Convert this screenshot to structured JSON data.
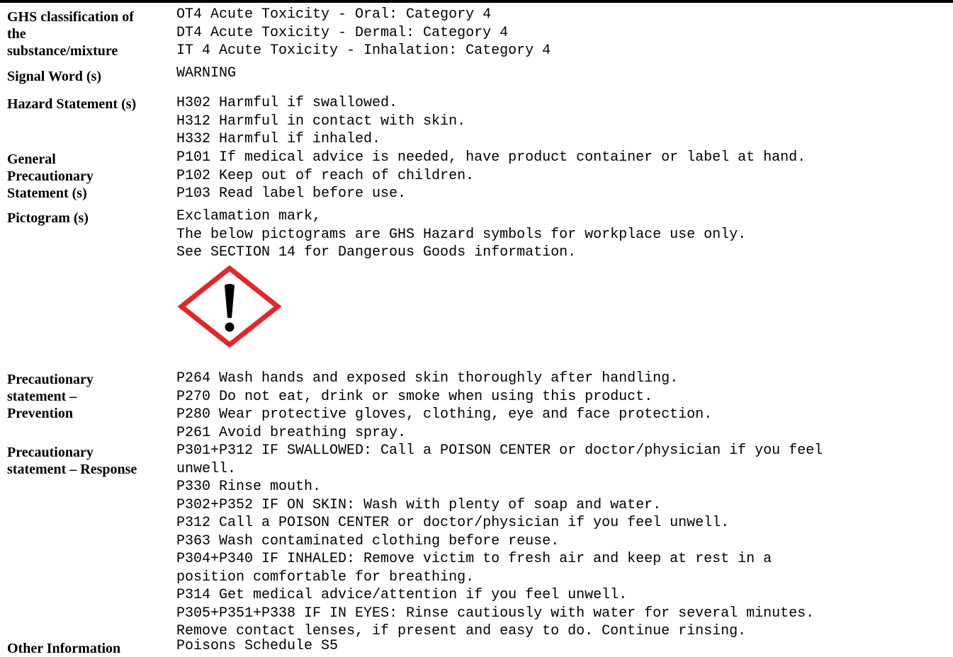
{
  "sections": [
    {
      "id": "ghs",
      "label_lines": [
        "GHS classification of",
        "the",
        "substance/mixture"
      ],
      "lines": [
        "OT4 Acute Toxicity - Oral: Category 4",
        "DT4 Acute Toxicity - Dermal: Category 4",
        "IT 4 Acute Toxicity - Inhalation: Category 4"
      ]
    },
    {
      "id": "signal",
      "label_lines": [
        "Signal Word (s)"
      ],
      "lines": [
        "WARNING"
      ]
    },
    {
      "id": "hazard",
      "label_lines": [
        "Hazard Statement (s)"
      ],
      "lines": [
        "H302 Harmful if swallowed.",
        "H312 Harmful in contact with skin.",
        "H332 Harmful if inhaled."
      ]
    },
    {
      "id": "general",
      "label_lines": [
        "General",
        "Precautionary",
        "Statement (s)"
      ],
      "lines": [
        "P101 If medical advice is needed, have product container or label at hand.",
        "P102 Keep out of reach of children.",
        "P103 Read label before use."
      ]
    },
    {
      "id": "pictogram",
      "label_lines": [
        "Pictogram (s)"
      ],
      "lines": [
        "Exclamation mark,",
        "The below pictograms are GHS Hazard symbols for workplace use only.",
        "See SECTION 14 for Dangerous Goods information."
      ],
      "pictogram_icon": "ghs-exclamation-mark-icon"
    },
    {
      "id": "prevention",
      "label_lines": [
        "Precautionary",
        "statement –",
        "Prevention"
      ],
      "lines": [
        "P264 Wash hands and exposed skin thoroughly after handling.",
        "P270 Do not eat, drink or smoke when using this product.",
        "P280 Wear protective gloves, clothing, eye and face protection.",
        "P261 Avoid breathing spray."
      ]
    },
    {
      "id": "response",
      "label_lines": [
        "Precautionary",
        "statement – Response"
      ],
      "lines": [
        "P301+P312 IF SWALLOWED: Call a POISON CENTER or doctor/physician if you feel",
        "unwell.",
        "P330 Rinse mouth.",
        "P302+P352 IF ON SKIN: Wash with plenty of soap and water.",
        "P312 Call a POISON CENTER or doctor/physician if you feel unwell.",
        "P363 Wash contaminated clothing before reuse.",
        "P304+P340 IF INHALED: Remove victim to fresh air and keep at rest in a",
        "position comfortable for breathing.",
        "P314 Get medical advice/attention if you feel unwell.",
        "P305+P351+P338 IF IN EYES: Rinse cautiously with water for several minutes.",
        "Remove contact lenses, if present and easy to do. Continue rinsing."
      ]
    },
    {
      "id": "other",
      "label_lines": [
        "Other Information"
      ],
      "lines": [
        "Poisons Schedule S5"
      ]
    }
  ],
  "colors": {
    "pictogram_border": "#e3262b",
    "pictogram_symbol": "#000000",
    "text": "#000000"
  }
}
